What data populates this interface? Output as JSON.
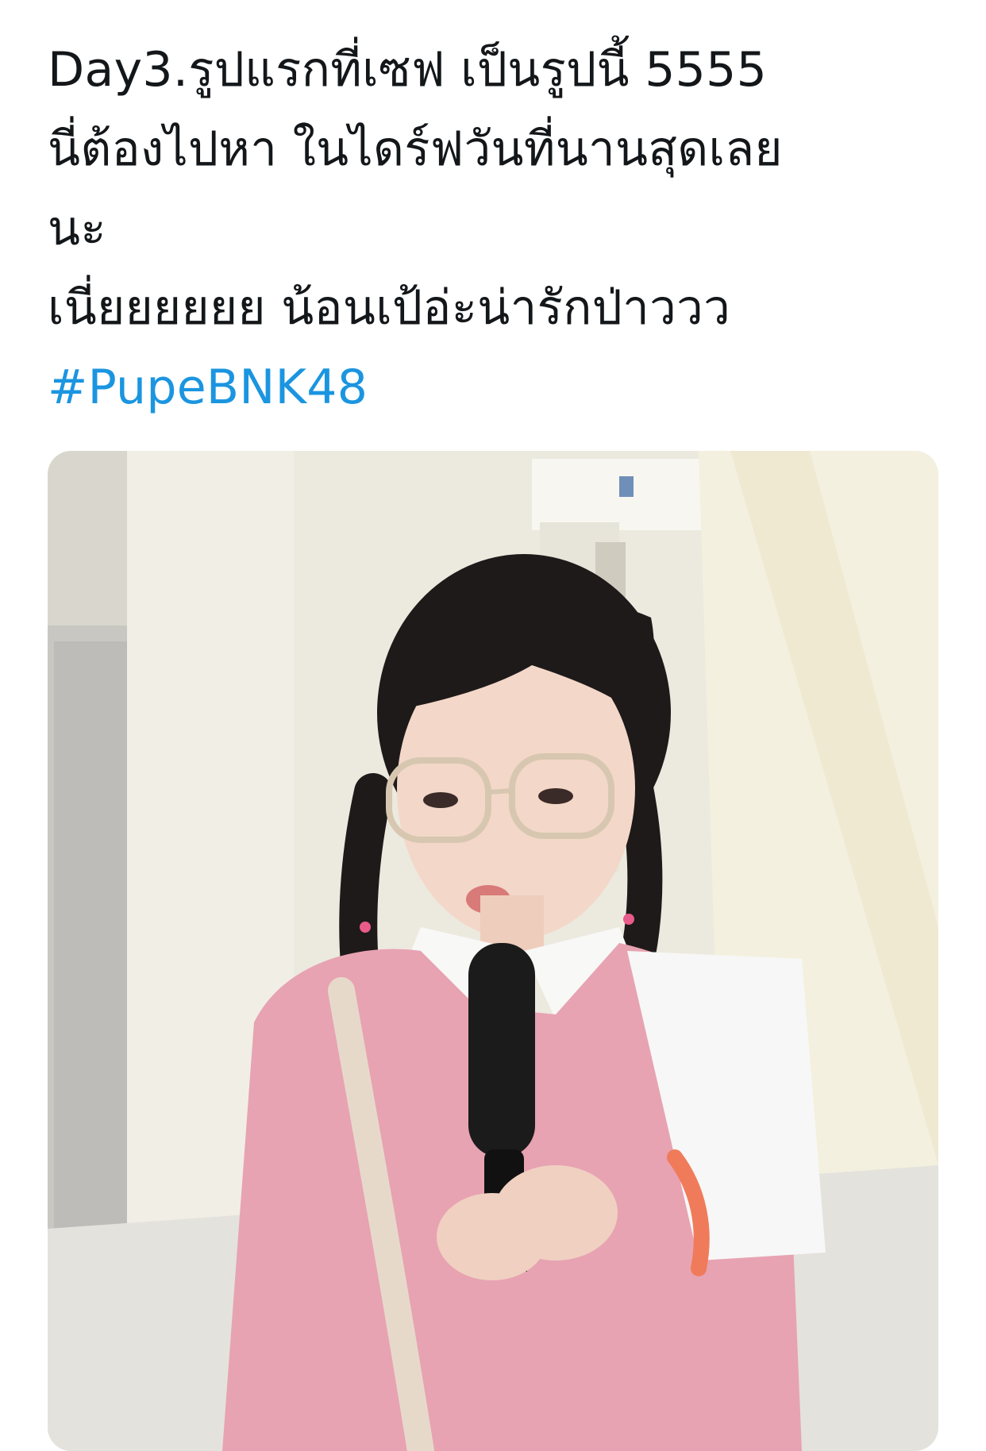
{
  "tweet": {
    "lines": [
      "Day3.รูปแรกที่เซฟ เป็นรูปนี้  5555",
      "นี่ต้องไปหา ในไดร์ฟวันที่นานสุดเลย",
      "นะ",
      "เนี่ยยยยยย น้อนเป้อ่ะน่ารักป่าววว"
    ],
    "hashtag": "#PupeBNK48",
    "link_color": "#1b95e0"
  }
}
